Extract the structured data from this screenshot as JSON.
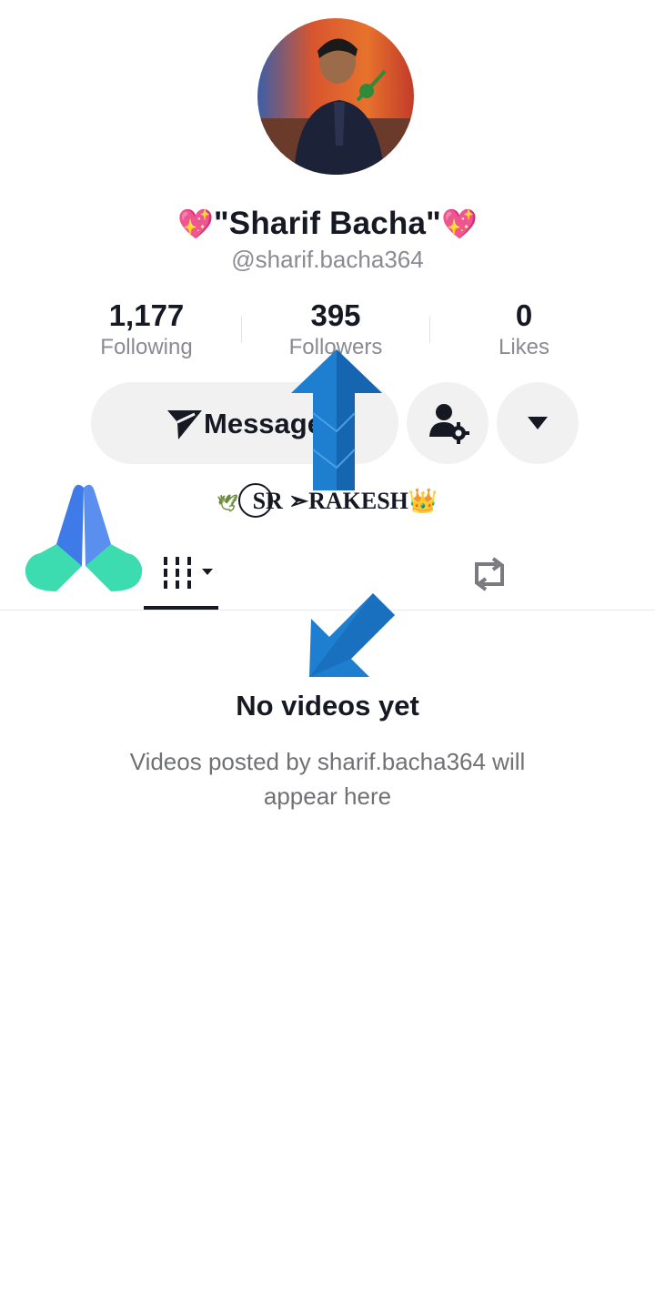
{
  "profile": {
    "display_name": "\"Sharif Bacha\"",
    "display_name_emoji": "💖",
    "username": "@sharif.bacha364",
    "bio": "SR ➣RAKESH",
    "bio_emoji": "👑"
  },
  "stats": [
    {
      "value": "1,177",
      "label": "Following"
    },
    {
      "value": "395",
      "label": "Followers"
    },
    {
      "value": "0",
      "label": "Likes"
    }
  ],
  "actions": {
    "message_label": "Message",
    "message_icon": "send-icon",
    "friend_settings_icon": "user-gear-icon",
    "more_icon": "dropdown-triangle-icon"
  },
  "tabs": [
    {
      "icon": "videos-grid-icon",
      "selected": true
    },
    {
      "icon": "repost-icon",
      "selected": false
    }
  ],
  "empty_state": {
    "title": "No videos yet",
    "description": "Videos posted by sharif.bacha364 will appear here"
  },
  "overlays": {
    "prayer_emoji": "🙏",
    "arrow_color": "#1e7fd0"
  }
}
